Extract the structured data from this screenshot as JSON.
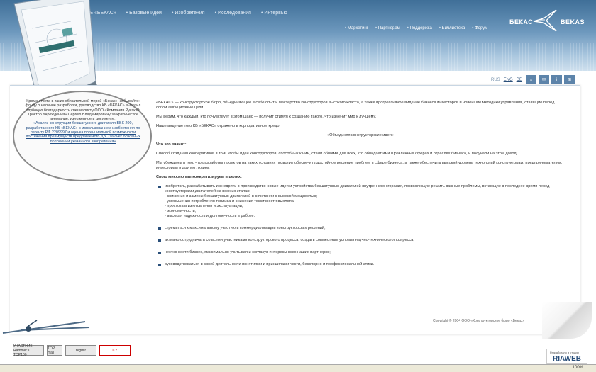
{
  "header": {
    "top_nav": [
      "КБ «БЕКАС»",
      "Базовые идеи",
      "Изобретения",
      "Исследования",
      "Интервью"
    ],
    "sub_nav": [
      "Маркетинг",
      "Партнерам",
      "Поддержка",
      "Библиотека",
      "Форум"
    ],
    "logo_left": "БЕКАС",
    "logo_right": "BEKAS"
  },
  "toolbar": {
    "lang_rus": "RUS",
    "lang_eng": "ENG",
    "lang_de": "DE",
    "btn_home": "⌂",
    "btn_mail": "✉",
    "btn_info": "i",
    "btn_map": "⊞"
  },
  "sidebar": {
    "text": "Кроме ответа в таких обязательной мерой «Бекас», забывайте: фонду о наличие разработки, руководство КБ «БЕКАС» выразил глубокую благодарность специалисту ООО «Компания Русский Трактор Учреждения» Сергею Владимировичу за критическое внимание, изложенное в документе:",
    "link": "«Анализ конструкции безшатунного двигателя ВБК-200, разработанного КБ «БЕКАС» с использованием изобретения по патенту РФ 2209997 и оценка потенциальной возможности достижения преимуществ предлагаемого ДВС за счет основных положений указанного изобретения»"
  },
  "content": {
    "p1": "«БЕКАС» — конструкторское бюро, объединяющее в себе опыт и мастерство конструкторов высокого класса, а также прогрессивное видение бизнеса инвесторов и новейшие методики управления, ставящие перед собой амбициозные цели.",
    "p2": "Мы верим, что каждый, кто почувствует в этом шанс — получит стимул к созданию такого, что изменит мир к лучшему.",
    "p3": "Наше видение того КБ «БЕКАС» отражено в корпоративном кредо:",
    "motto": "«Объединяя конструкторские идеи»",
    "h_what": "Что это значит:",
    "p4": "Способ создания кооперативов в том, чтобы идеи конструкторов, способных к ним, стали общими для всех, кто обладает ими в различных сферах и отраслях бизнеса, и получали на этом доход.",
    "p5": "Мы убеждены в том, что разработка проектов на таких условиях позволит обеспечить достойное решение проблем в сфере бизнеса, а также обеспечить высокий уровень технологий конструкторам, предпринимателям, инвесторам и другим людям.",
    "h_goals": "Свою миссию мы конкретизируем в целях:",
    "goal1": "изобретать, разрабатывать и внедрять в производство новые идеи и устройства безшатунных двигателей внутреннего сгорания, позволяющие решить важные проблемы, встающие в последнее время перед конструкторами двигателей на всех их этапах:",
    "goal1_sub": [
      "- снижения и замены безшатунных двигателей в сочетании с высокой мощностью;",
      "- уменьшения потребления топлива и снижения токсичности выхлопа;",
      "- простота в изготовлении и эксплуатации;",
      "- экономичности;",
      "- высокая надежность и долговечность в работе."
    ],
    "goal2": "стремиться к максимальному участию в коммерциализации конструкторских решений;",
    "goal3": "активно сотрудничать со всеми участниками конструкторского процесса, создать совместные условия научно-технического прогресса;",
    "goal4": "честно вести бизнес, максимально учитывая и согласуя интересы всех наших партнеров;",
    "goal5": "руководствоваться в своей деятельности понятиями и принципами чести, бесспорно и профессиональной этики."
  },
  "footer": {
    "copyright": "Copyright © 2004 ООО «Конструкторское бюро «Бекас»"
  },
  "badges": {
    "b1": "УЧАСТНИК Rambler's TOP100",
    "b2": "TOP mail",
    "b3": "Bigmir",
    "b4": "CY",
    "riaweb_small": "Разработано в студии",
    "riaweb": "RIAWEB"
  },
  "status": {
    "zoom": "100%"
  },
  "colors": {
    "header_dark": "#3f6f98",
    "header_light": "#cfe0ee",
    "accent": "#2a4f7a",
    "link": "#1f4d85"
  }
}
